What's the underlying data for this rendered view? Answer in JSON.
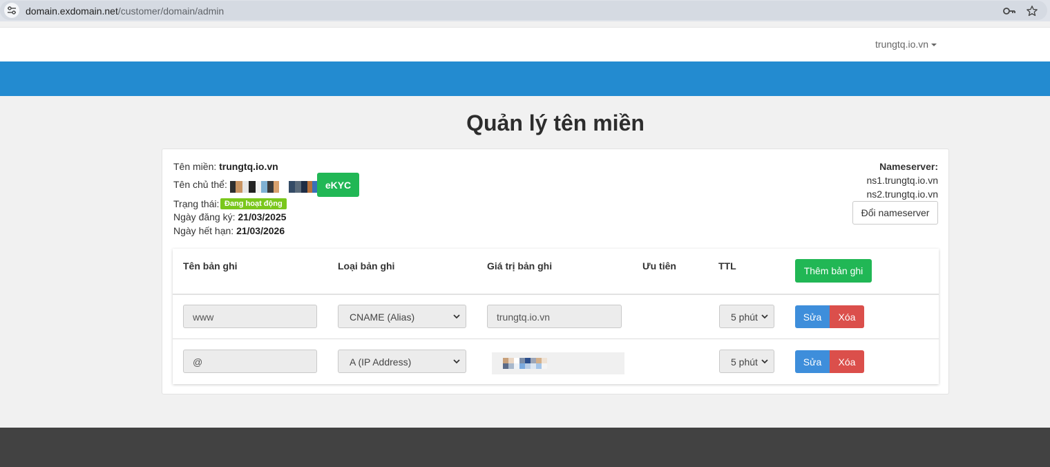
{
  "browser": {
    "url_domain": "domain.exdomain.net",
    "url_path": "/customer/domain/admin"
  },
  "header": {
    "user_menu": "trungtq.io.vn"
  },
  "page": {
    "title": "Quản lý tên miền"
  },
  "domain_info": {
    "domain_label": "Tên miền:",
    "domain_value": "trungtq.io.vn",
    "owner_label": "Tên chủ thể:",
    "ekyc_button": "eKYC",
    "status_label": "Trạng thái:",
    "status_value": "Đang hoạt động",
    "registered_label": "Ngày đăng ký:",
    "registered_value": "21/03/2025",
    "expiry_label": "Ngày hết hạn:",
    "expiry_value": "21/03/2026"
  },
  "nameserver": {
    "label": "Nameserver:",
    "servers": [
      "ns1.trungtq.io.vn",
      "ns2.trungtq.io.vn"
    ],
    "change_button": "Đổi nameserver"
  },
  "records_table": {
    "headers": {
      "name": "Tên bản ghi",
      "type": "Loại bản ghi",
      "value": "Giá trị bản ghi",
      "priority": "Ưu tiên",
      "ttl": "TTL"
    },
    "add_button": "Thêm bản ghi",
    "edit_label": "Sửa",
    "delete_label": "Xóa",
    "rows": [
      {
        "name": "www",
        "type": "CNAME (Alias)",
        "value": "trungtq.io.vn",
        "ttl": "5 phút"
      },
      {
        "name": "@",
        "type": "A (IP Address)",
        "ttl": "5 phút"
      }
    ]
  },
  "colors": {
    "accent_blue": "#238bd0",
    "success_green": "#21b755",
    "danger_red": "#db4f4b",
    "status_badge": "#7ac71c",
    "footer": "#424242"
  }
}
